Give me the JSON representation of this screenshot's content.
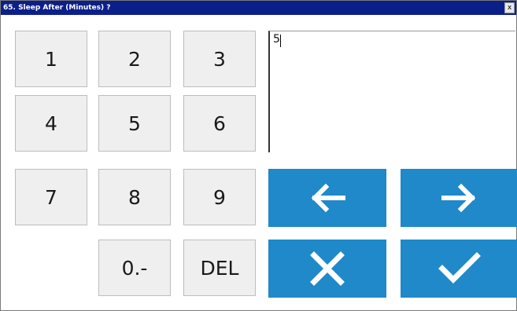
{
  "window": {
    "title": "65. Sleep After (Minutes) ?",
    "close_glyph": "x"
  },
  "display": {
    "value": "5"
  },
  "keypad": {
    "keys": [
      "1",
      "2",
      "3",
      "4",
      "5",
      "6",
      "7",
      "8",
      "9",
      "0.-",
      "DEL"
    ]
  },
  "actions": {
    "left_icon": "arrow-left-icon",
    "right_icon": "arrow-right-icon",
    "cancel_icon": "x-icon",
    "confirm_icon": "check-icon"
  },
  "colors": {
    "titlebar": "#0b1f8a",
    "key_background": "#efefef",
    "action_blue": "#1f89c9"
  }
}
